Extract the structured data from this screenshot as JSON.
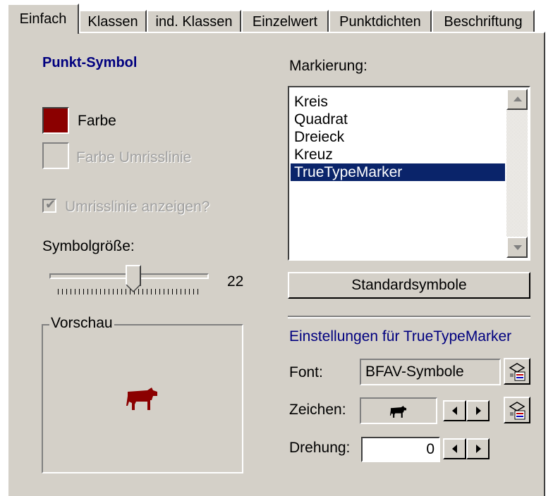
{
  "tabs": [
    {
      "label": "Einfach",
      "active": true
    },
    {
      "label": "Klassen",
      "active": false
    },
    {
      "label": "ind. Klassen",
      "active": false
    },
    {
      "label": "Einzelwert",
      "active": false
    },
    {
      "label": "Punktdichten",
      "active": false
    },
    {
      "label": "Beschriftung",
      "active": false
    }
  ],
  "left": {
    "heading": "Punkt-Symbol",
    "color_label": "Farbe",
    "color_value": "#8b0000",
    "outline_color_label": "Farbe Umrisslinie",
    "show_outline_label": "Umrisslinie anzeigen?",
    "show_outline_checked": true,
    "size_label": "Symbolgröße:",
    "size_value": "22",
    "size_fraction": 0.55,
    "preview_label": "Vorschau",
    "preview_icon": "cow-icon"
  },
  "right": {
    "marker_label": "Markierung:",
    "marker_options": [
      "Kreis",
      "Quadrat",
      "Dreieck",
      "Kreuz",
      "TrueTypeMarker"
    ],
    "selected_marker": "TrueTypeMarker",
    "standard_button": "Standardsymbole",
    "settings_heading": "Einstellungen für TrueTypeMarker",
    "font_label": "Font:",
    "font_value": "BFAV-Symbole",
    "char_label": "Zeichen:",
    "char_icon": "cow-icon",
    "rotation_label": "Drehung:",
    "rotation_value": "0"
  },
  "colors": {
    "accent_heading": "#00007f",
    "selection": "#0a246a",
    "symbol": "#8b0000",
    "dialog_bg": "#d4d0c8"
  }
}
